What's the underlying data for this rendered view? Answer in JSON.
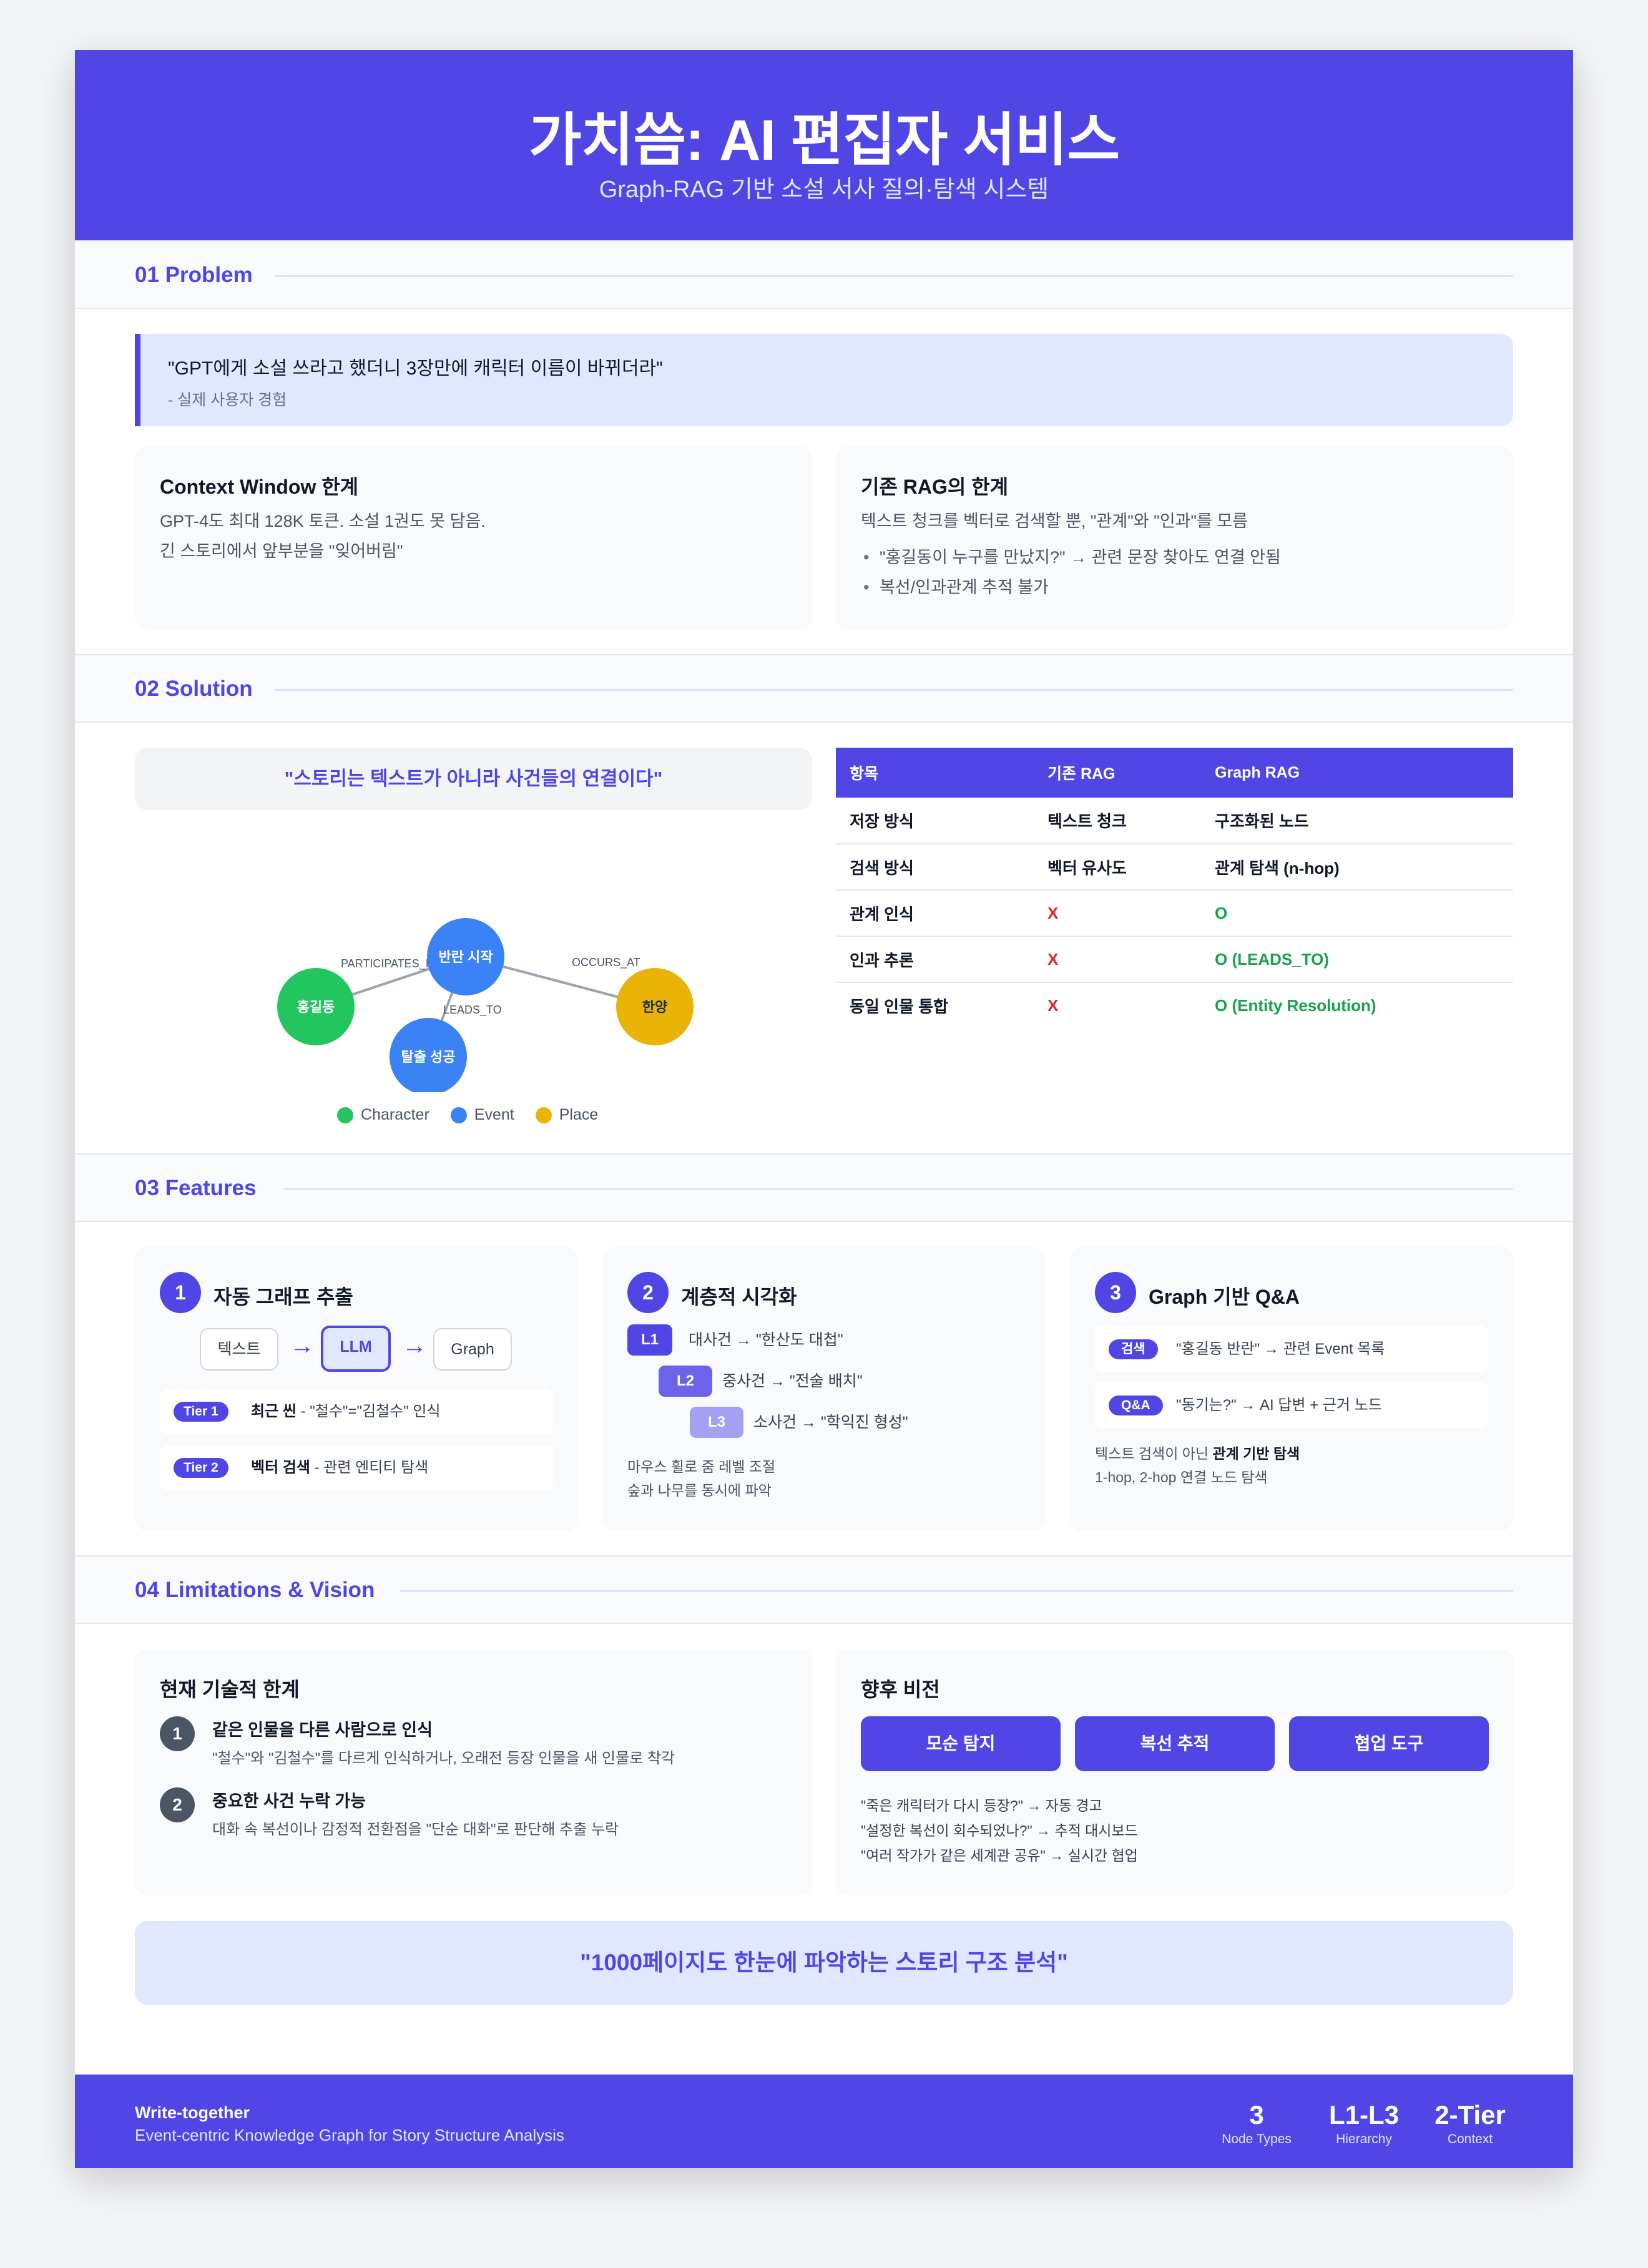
{
  "header": {
    "title": "가치씀: AI 편집자 서비스",
    "subtitle": "Graph-RAG 기반 소설 서사 질의·탐색 시스템"
  },
  "sections": {
    "problem": "01 Problem",
    "solution": "02 Solution",
    "features": "03 Features",
    "limits": "04 Limitations & Vision"
  },
  "problem": {
    "quote": "\"GPT에게 소설 쓰라고 했더니 3장만에 캐릭터 이름이 바뀌더라\"",
    "quote_source": "- 실제 사용자 경험",
    "context_window": {
      "title": "Context Window 한계",
      "lines": [
        "GPT-4도 최대 128K 토큰. 소설 1권도 못 담음.",
        "긴 스토리에서 앞부분을 \"잊어버림\""
      ]
    },
    "rag_limit": {
      "title": "기존 RAG의 한계",
      "desc": "텍스트 청크를 벡터로 검색할 뿐, \"관계\"와 \"인과\"를 모름",
      "bullets": [
        "\"홍길동이 누구를 만났지?\" → 관련 문장 찾아도 연결 안됨",
        "복선/인과관계 추적 불가"
      ]
    }
  },
  "solution": {
    "slogan": "\"스토리는 텍스트가 아니라 사건들의 연결이다\"",
    "graph": {
      "nodes": [
        {
          "id": "hong",
          "label": "홍길동",
          "type": "Character",
          "color": "#22c55e"
        },
        {
          "id": "revolt",
          "label": "반란 시작",
          "type": "Event",
          "color": "#3b82f6"
        },
        {
          "id": "escape",
          "label": "탈출 성공",
          "type": "Event",
          "color": "#3b82f6"
        },
        {
          "id": "hanyang",
          "label": "한양",
          "type": "Place",
          "color": "#eab308"
        }
      ],
      "edges": [
        {
          "from": "hong",
          "to": "revolt",
          "label": "PARTICIPATES_IN"
        },
        {
          "from": "revolt",
          "to": "hanyang",
          "label": "OCCURS_AT"
        },
        {
          "from": "revolt",
          "to": "escape",
          "label": "LEADS_TO"
        }
      ]
    },
    "legend": [
      {
        "label": "Character",
        "color": "#22c55e"
      },
      {
        "label": "Event",
        "color": "#3b82f6"
      },
      {
        "label": "Place",
        "color": "#eab308"
      }
    ],
    "table": {
      "headers": [
        "항목",
        "기존 RAG",
        "Graph RAG"
      ],
      "rows": [
        [
          "저장 방식",
          "텍스트 청크",
          "구조화된 노드"
        ],
        [
          "검색 방식",
          "벡터 유사도",
          "관계 탐색 (n-hop)"
        ],
        [
          "관계 인식",
          "X",
          "O"
        ],
        [
          "인과 추론",
          "X",
          "O (LEADS_TO)"
        ],
        [
          "동일 인물 통합",
          "X",
          "O (Entity Resolution)"
        ]
      ]
    }
  },
  "features": {
    "f1": {
      "num": "1",
      "title": "자동 그래프 추출",
      "flow": [
        "텍스트",
        "LLM",
        "Graph"
      ],
      "arrow": "→",
      "tier1": {
        "pill": "Tier 1",
        "bold": "최근 씬",
        "rest": " - \"철수\"=\"김철수\" 인식"
      },
      "tier2": {
        "pill": "Tier 2",
        "bold": "벡터 검색",
        "rest": " - 관련 엔티티 탐색"
      }
    },
    "f2": {
      "num": "2",
      "title": "계층적 시각화",
      "levels": [
        {
          "tag": "L1",
          "text": "대사건 → \"한산도 대첩\""
        },
        {
          "tag": "L2",
          "text": "중사건 → \"전술 배치\""
        },
        {
          "tag": "L3",
          "text": "소사건 → \"학익진 형성\""
        }
      ],
      "notes": [
        "마우스 휠로 줌 레벨 조절",
        "숲과 나무를 동시에 파악"
      ]
    },
    "f3": {
      "num": "3",
      "title": "Graph 기반 Q&A",
      "rows": [
        {
          "pill": "검색",
          "text": "\"홍길동 반란\" → 관련 Event 목록"
        },
        {
          "pill": "Q&A",
          "text": "\"동기는?\" → AI 답변 + 근거 노드"
        }
      ],
      "note1_pre": "텍스트 검색이 아닌 ",
      "note1_bold": "관계 기반 탐색",
      "note2": "1-hop, 2-hop 연결 노드 탐색"
    }
  },
  "limits": {
    "current": {
      "title": "현재 기술적 한계",
      "items": [
        {
          "num": "1",
          "title": "같은 인물을 다른 사람으로 인식",
          "text": "\"철수\"와 \"김철수\"를 다르게 인식하거나, 오래전 등장 인물을 새 인물로 착각"
        },
        {
          "num": "2",
          "title": "중요한 사건 누락 가능",
          "text": "대화 속 복선이나 감정적 전환점을 \"단순 대화\"로 판단해 추출 누락"
        }
      ]
    },
    "vision": {
      "title": "향후 비전",
      "buttons": [
        "모순 탐지",
        "복선 추적",
        "협업 도구"
      ],
      "lines": [
        "\"죽은 캐릭터가 다시 등장?\" → 자동 경고",
        "\"설정한 복선이 회수되었나?\" → 추적 대시보드",
        "\"여러 작가가 같은 세계관 공유\" → 실시간 협업"
      ]
    },
    "bottom_quote": "\"1000페이지도 한눈에 파악하는 스토리 구조 분석\""
  },
  "footer": {
    "brand": "Write-together",
    "desc": "Event-centric Knowledge Graph for Story Structure Analysis",
    "stats": [
      {
        "value": "3",
        "label": "Node Types"
      },
      {
        "value": "L1-L3",
        "label": "Hierarchy"
      },
      {
        "value": "2-Tier",
        "label": "Context"
      }
    ]
  }
}
